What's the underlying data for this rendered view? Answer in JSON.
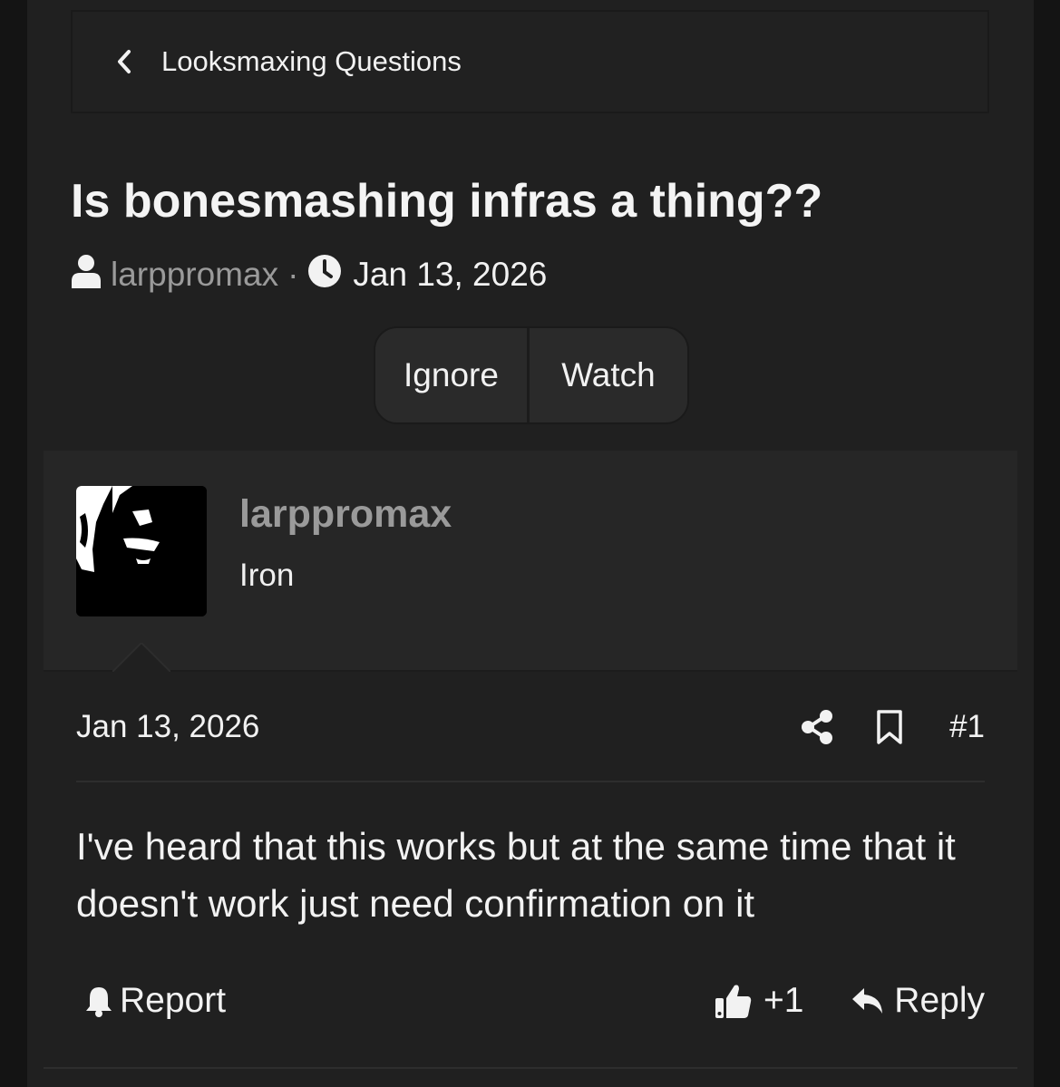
{
  "breadcrumb": {
    "icon": "chevron-left-icon",
    "label": "Looksmaxing Questions"
  },
  "thread": {
    "title": "Is bonesmashing infras a thing??",
    "author": "larppromax",
    "separator": "·",
    "date": "Jan 13, 2026"
  },
  "buttons": {
    "ignore": "Ignore",
    "watch": "Watch"
  },
  "post": {
    "username": "larppromax",
    "rank": "Iron",
    "date": "Jan 13, 2026",
    "number": "#1",
    "body": "I've heard that this works but at the same time that it doesn't work just need confirmation on it",
    "report_label": "Report",
    "reaction_count": "+1",
    "reply_label": "Reply"
  },
  "colors": {
    "background": "#202020",
    "panel": "#262626",
    "muted_text": "#9a9a9a",
    "text": "#f2f2f2"
  }
}
